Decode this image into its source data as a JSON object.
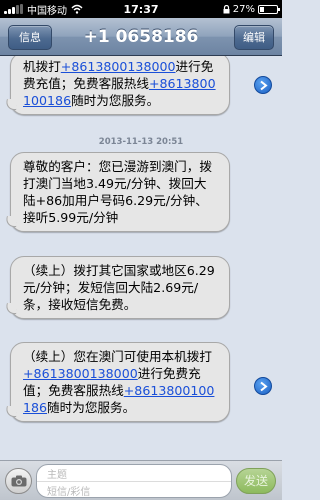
{
  "status_bar": {
    "carrier": "中国移动",
    "time": "17:37",
    "battery_percent_label": "27%",
    "battery_level": 0.27
  },
  "nav": {
    "back_label": "信息",
    "title": "+1 0658186",
    "edit_label": "编辑"
  },
  "messages": [
    {
      "parts": [
        {
          "text": "机拨打"
        },
        {
          "text": "+8613800138000",
          "link": true
        },
        {
          "text": "进行免费充值；免费客服热线"
        },
        {
          "text": "+8613800100186",
          "link": true
        },
        {
          "text": "随时为您服务。"
        }
      ],
      "forward_button": true
    },
    {
      "timestamp": "2013-11-13 20:51",
      "parts": [
        {
          "text": "尊敬的客户：您已漫游到澳门，拨打澳门当地3.49元/分钟、拨回大陆+86加用户号码6.29元/分钟、接听5.99元/分钟"
        }
      ],
      "forward_button": false
    },
    {
      "parts": [
        {
          "text": "（续上）拨打其它国家或地区6.29元/分钟；发短信回大陆2.69元/条，接收短信免费。"
        }
      ],
      "forward_button": false
    },
    {
      "parts": [
        {
          "text": "（续上）您在澳门可使用本机拨打"
        },
        {
          "text": "+8613800138000",
          "link": true
        },
        {
          "text": "进行免费充值；免费客服热线"
        },
        {
          "text": "+8613800100186",
          "link": true
        },
        {
          "text": "随时为您服务。"
        }
      ],
      "forward_button": true
    }
  ],
  "compose": {
    "subject_placeholder": "主题",
    "body_placeholder": "短信/彩信",
    "send_label": "发送"
  },
  "icons": [
    "signal-icon",
    "wifi-icon",
    "lock-icon",
    "battery-icon",
    "forward-icon",
    "camera-icon"
  ],
  "colors": {
    "link": "#1a4fd8",
    "bubble": "#e6e6e6",
    "background": "#dbe2ed",
    "send_button": "#9cc56f"
  }
}
